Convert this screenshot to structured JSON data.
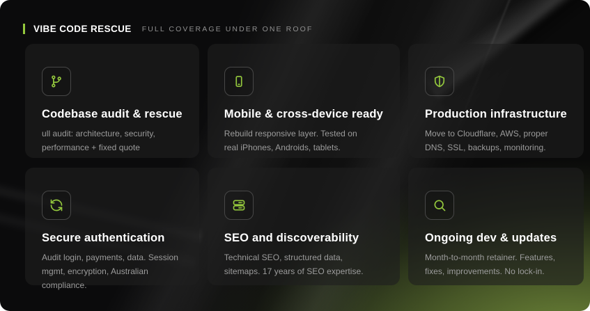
{
  "header": {
    "brand": "VIBE CODE RESCUE",
    "tagline": "FULL COVERAGE UNDER ONE ROOF"
  },
  "theme": {
    "accent_green": "#94C83D",
    "background_dark": "#0A0A0B",
    "glow_olive": "#5A7030",
    "card_title_color": "#FFFFFF",
    "card_text_color": "#9C9C9C"
  },
  "cards": [
    {
      "icon": "git-branch-icon",
      "title": "Codebase audit & rescue",
      "description": "ull audit: architecture, security, performance + fixed quote"
    },
    {
      "icon": "smartphone-icon",
      "title": "Mobile & cross-device ready",
      "description": "Rebuild responsive layer. Tested on real iPhones, Androids, tablets."
    },
    {
      "icon": "shield-icon",
      "title": "Production infrastructure",
      "description": "Move to Cloudflare, AWS, proper DNS, SSL, backups, monitoring."
    },
    {
      "icon": "refresh-icon",
      "title": "Secure authentication",
      "description": "Audit login, payments, data. Session mgmt, encryption, Australian compliance."
    },
    {
      "icon": "server-icon",
      "title": "SEO and discoverability",
      "description": "Technical SEO, structured data, sitemaps. 17 years of SEO expertise."
    },
    {
      "icon": "search-icon",
      "title": "Ongoing dev & updates",
      "description": "Month-to-month retainer. Features, fixes, improvements. No lock-in."
    }
  ]
}
